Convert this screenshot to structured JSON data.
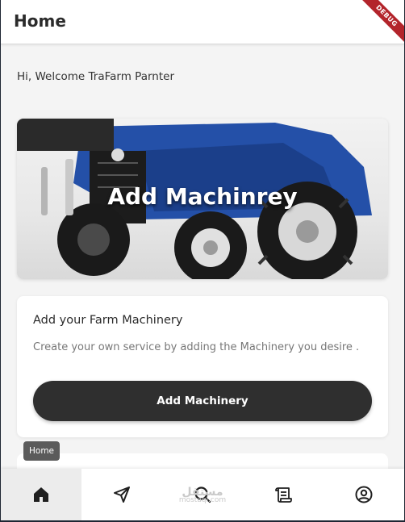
{
  "appbar": {
    "title": "Home"
  },
  "debug_banner": {
    "label": "DEBUG"
  },
  "welcome": {
    "text": "Hi, Welcome TraFarm Parnter"
  },
  "banner": {
    "title": "Add Machinrey"
  },
  "info_card": {
    "heading": "Add your Farm Machinery",
    "description": "Create your own service by adding the Machinery you desire .",
    "button_label": "Add Machinery"
  },
  "tooltip": {
    "text": "Home"
  },
  "bottom_nav": {
    "items": [
      {
        "icon": "home-icon",
        "active": true
      },
      {
        "icon": "send-icon",
        "active": false
      },
      {
        "icon": "search-icon",
        "active": false
      },
      {
        "icon": "scroll-icon",
        "active": false
      },
      {
        "icon": "account-circle-icon",
        "active": false
      }
    ]
  },
  "watermark": {
    "logo": "مستقل",
    "site": "mostaql.com"
  },
  "colors": {
    "button": "#2f2f2f",
    "active_nav": "#ececec",
    "tractor_blue": "#2450a8",
    "debug_red": "#b3242b"
  }
}
